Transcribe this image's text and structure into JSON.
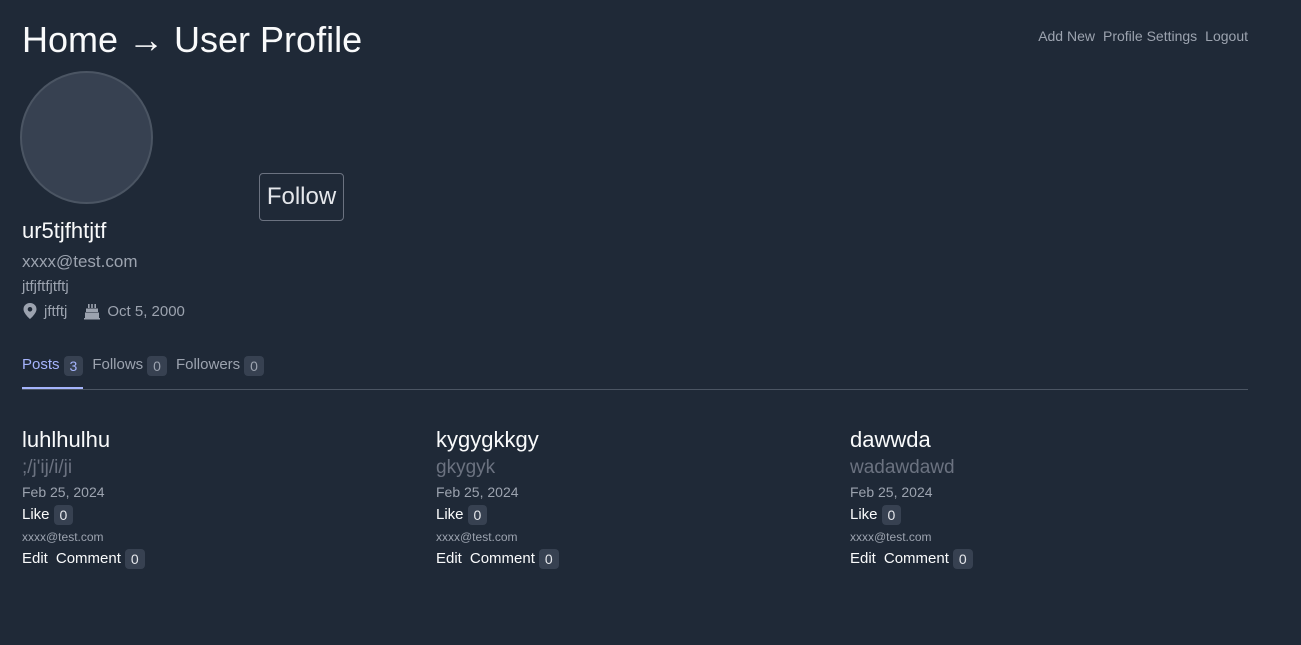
{
  "header": {
    "title": "Home → User Profile",
    "nav": [
      "Add New",
      "Profile Settings",
      "Logout"
    ]
  },
  "profile": {
    "follow_label": "Follow",
    "username": "ur5tjfhtjtf",
    "email": "xxxx@test.com",
    "bio": "jtfjftfjtftj",
    "location": "jftftj",
    "birthday": "Oct 5, 2000"
  },
  "tabs": [
    {
      "label": "Posts",
      "count": "3",
      "active": true
    },
    {
      "label": "Follows",
      "count": "0",
      "active": false
    },
    {
      "label": "Followers",
      "count": "0",
      "active": false
    }
  ],
  "posts": [
    {
      "title": "luhlhulhu",
      "body": ";/j'ij/i/ji",
      "date": "Feb 25, 2024",
      "like_label": "Like",
      "likes": "0",
      "author": "xxxx@test.com",
      "edit_label": "Edit",
      "comment_label": "Comment",
      "comments": "0"
    },
    {
      "title": "kygygkkgy",
      "body": "gkygyk",
      "date": "Feb 25, 2024",
      "like_label": "Like",
      "likes": "0",
      "author": "xxxx@test.com",
      "edit_label": "Edit",
      "comment_label": "Comment",
      "comments": "0"
    },
    {
      "title": "dawwda",
      "body": "wadawdawd",
      "date": "Feb 25, 2024",
      "like_label": "Like",
      "likes": "0",
      "author": "xxxx@test.com",
      "edit_label": "Edit",
      "comment_label": "Comment",
      "comments": "0"
    }
  ],
  "colors": {
    "background": "#1f2937",
    "accent": "#a5b4fc",
    "muted": "#9ca3af"
  }
}
